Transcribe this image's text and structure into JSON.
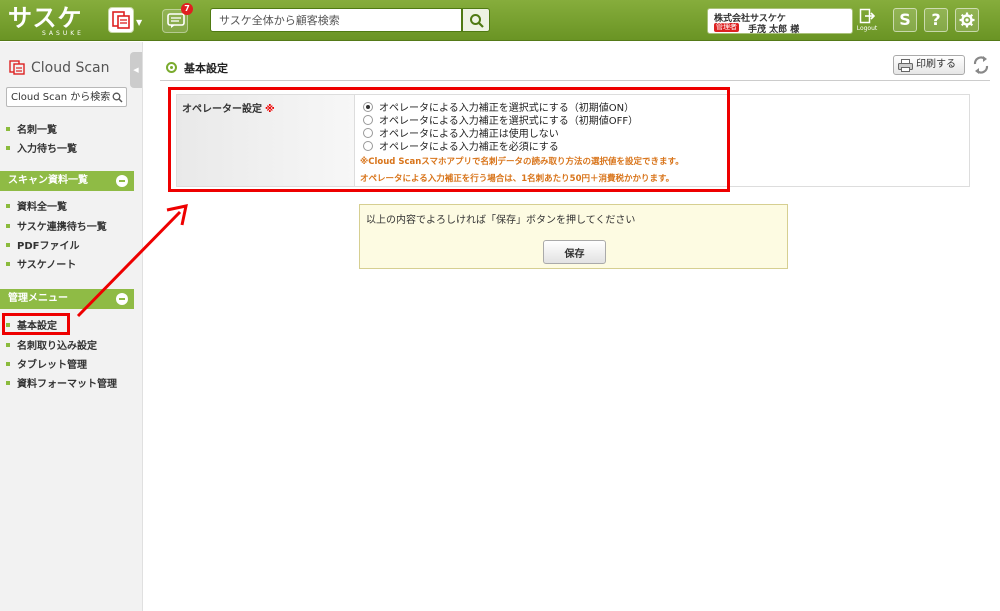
{
  "header": {
    "logo_text": "サスケ",
    "logo_sub": "SASUKE",
    "notification_count": "7",
    "search_placeholder": "サスケ全体から顧客検索",
    "company": "株式会社サスケケ",
    "role_badge": "管理者",
    "user_name": "手茂 太郎 様",
    "logout_label": "Logout",
    "tool_s": "S",
    "tool_help": "?"
  },
  "sidebar": {
    "app_title": "Cloud Scan",
    "search_placeholder": "Cloud Scan から検索",
    "top_items": [
      "名刺一覧",
      "入力待ち一覧"
    ],
    "section_scan": "スキャン資料一覧",
    "scan_items": [
      "資料全一覧",
      "サスケ連携待ち一覧",
      "PDFファイル",
      "サスケノート"
    ],
    "section_admin": "管理メニュー",
    "admin_items": [
      "基本設定",
      "名刺取り込み設定",
      "タブレット管理",
      "資料フォーマット管理"
    ]
  },
  "main": {
    "title": "基本設定",
    "print_label": "印刷する",
    "field_label": "オペレーター設定",
    "required_mark": "※",
    "options": [
      "オペレータによる入力補正を選択式にする（初期値ON）",
      "オペレータによる入力補正を選択式にする（初期値OFF）",
      "オペレータによる入力補正は使用しない",
      "オペレータによる入力補正を必須にする"
    ],
    "selected_option": 0,
    "note1": "※Cloud Scanスマホアプリで名刺データの読み取り方法の選択値を設定できます。",
    "note2": "オペレータによる入力補正を行う場合は、1名刺あたり50円＋消費税かかります。",
    "confirm_text": "以上の内容でよろしければ「保存」ボタンを押してください",
    "save_label": "保存"
  },
  "colors": {
    "brand_green": "#7aab2e",
    "highlight_red": "#ee0000",
    "note_orange": "#d8741a"
  }
}
